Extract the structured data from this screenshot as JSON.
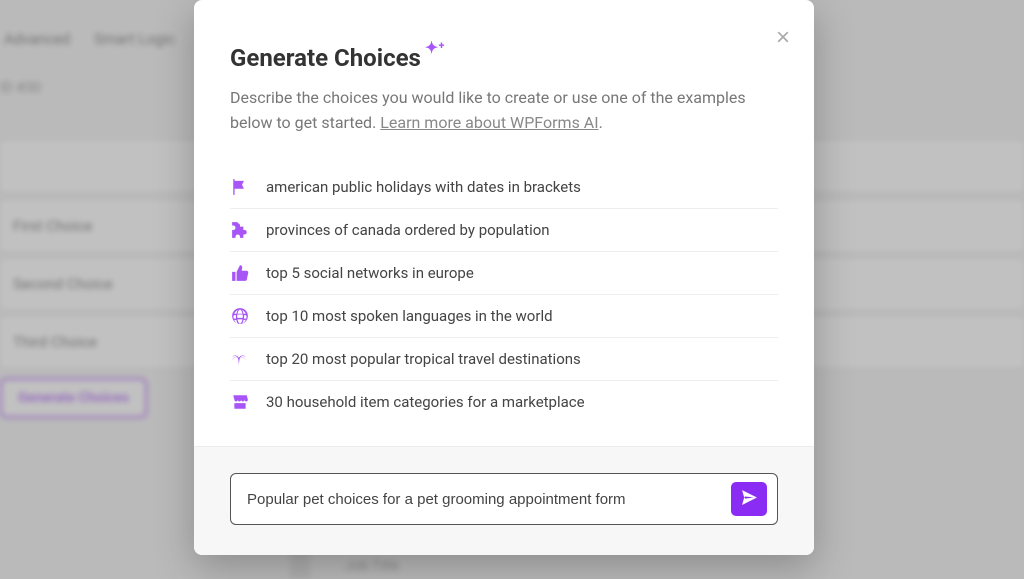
{
  "bg": {
    "tabs": [
      "Advanced",
      "Smart Logic"
    ],
    "id_label": "ID #30",
    "choice_1": "First Choice",
    "choice_2": "Second Choice",
    "choice_3": "Third Choice",
    "gen_button": "Generate Choices",
    "bottom_label": "Job Title"
  },
  "modal": {
    "title": "Generate Choices",
    "description": "Describe the choices you would like to create or use one of the examples below to get started. ",
    "learn_link": "Learn more about WPForms AI",
    "examples": [
      {
        "icon": "flag-icon",
        "text": "american public holidays with dates in brackets"
      },
      {
        "icon": "puzzle-icon",
        "text": "provinces of canada ordered by population"
      },
      {
        "icon": "thumbs-up-icon",
        "text": "top 5 social networks in europe"
      },
      {
        "icon": "globe-icon",
        "text": "top 10 most spoken languages in the world"
      },
      {
        "icon": "palm-tree-icon",
        "text": "top 20 most popular tropical travel destinations"
      },
      {
        "icon": "store-icon",
        "text": "30 household item categories for a marketplace"
      }
    ],
    "prompt_value": "Popular pet choices for a pet grooming appointment form"
  }
}
